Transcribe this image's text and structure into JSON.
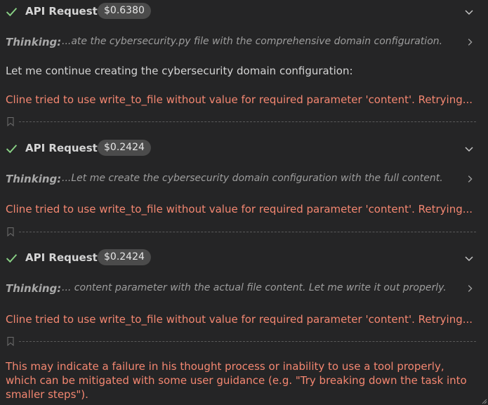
{
  "requests": [
    {
      "title": "API Request",
      "cost": "$0.6380",
      "thinking_label": "Thinking:",
      "thinking_text": "...ate the cybersecurity.py file with the comprehensive domain configuration.",
      "message": "Let me continue creating the cybersecurity domain configuration:",
      "error": "Cline tried to use write_to_file without value for required parameter 'content'. Retrying..."
    },
    {
      "title": "API Request",
      "cost": "$0.2424",
      "thinking_label": "Thinking:",
      "thinking_text": "...Let me create the cybersecurity domain configuration with the full content.",
      "error": "Cline tried to use write_to_file without value for required parameter 'content'. Retrying..."
    },
    {
      "title": "API Request",
      "cost": "$0.2424",
      "thinking_label": "Thinking:",
      "thinking_text": "... content parameter with the actual file content. Let me write it out properly.",
      "error": "Cline tried to use write_to_file without value for required parameter 'content'. Retrying..."
    }
  ],
  "warning": "This may indicate a failure in his thought process or inability to use a tool properly, which can be mitigated with some user guidance (e.g. \"Try breaking down the task into smaller steps\").",
  "colors": {
    "background": "#252526",
    "success": "#89d185",
    "error": "#f48771",
    "badge": "#4b4b4b"
  },
  "icons": {
    "status": "check-icon",
    "expand": "chevron-down-icon",
    "thinking_expand": "chevron-right-icon",
    "checkpoint": "bookmark-icon"
  }
}
